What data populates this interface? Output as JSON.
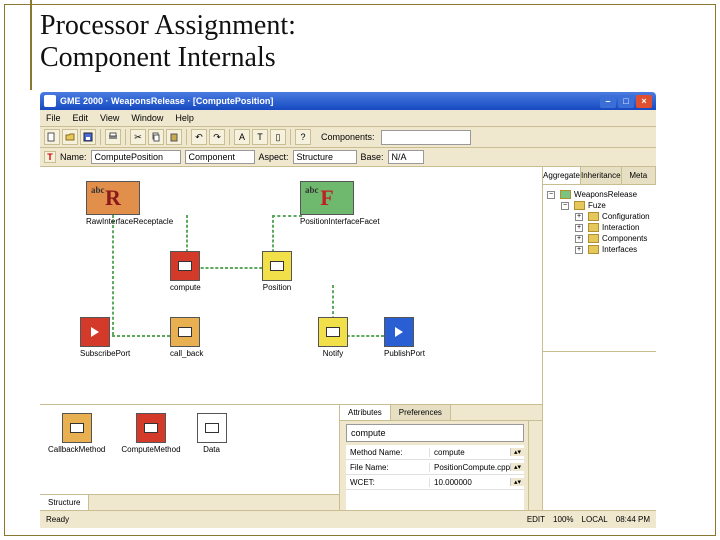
{
  "slide": {
    "title_line1": "Processor Assignment:",
    "title_line2": "Component Internals"
  },
  "window": {
    "title": "GME 2000 · WeaponsRelease · [ComputePosition]",
    "menu": [
      "File",
      "Edit",
      "View",
      "Window",
      "Help"
    ],
    "toolbar_components_label": "Components:",
    "optionbar": {
      "name_label": "Name:",
      "name_value": "ComputePosition",
      "base_label": "Component",
      "aspect_label": "Aspect:",
      "aspect_value": "Structure",
      "base2_label": "Base:",
      "base2_value": "N/A"
    }
  },
  "canvas": {
    "nodes": {
      "receptacle": {
        "letter": "R",
        "caption": "RawInterfaceReceptacle"
      },
      "facet": {
        "letter": "F",
        "caption": "PositionInterfaceFacet"
      },
      "compute": {
        "caption": "compute"
      },
      "position": {
        "caption": "Position"
      },
      "subscribe": {
        "caption": "SubscribePort"
      },
      "callback": {
        "caption": "call_back"
      },
      "notify": {
        "caption": "Notify"
      },
      "publish": {
        "caption": "PublishPort"
      }
    }
  },
  "sidebar": {
    "tabs": [
      "Aggregate",
      "Inheritance",
      "Meta"
    ],
    "tree": {
      "root": "WeaponsRelease",
      "children": [
        {
          "label": "Fuze",
          "children": [
            "Configuration",
            "Interaction",
            "Components",
            "Interfaces"
          ]
        }
      ]
    }
  },
  "palette": {
    "items": [
      {
        "label": "CallbackMethod",
        "box_class": "port-orange"
      },
      {
        "label": "ComputeMethod",
        "box_class": "port-red"
      },
      {
        "label": "Data",
        "box_class": "port-white"
      }
    ],
    "tab": "Structure"
  },
  "props": {
    "tabs": [
      "Attributes",
      "Preferences"
    ],
    "object_name": "compute",
    "rows": [
      {
        "key": "Method Name:",
        "val": "compute"
      },
      {
        "key": "File Name:",
        "val": "PositionCompute.cpp"
      },
      {
        "key": "WCET:",
        "val": "10.000000"
      }
    ]
  },
  "status": {
    "left": "Ready",
    "right": [
      "EDIT",
      "100%",
      "LOCAL",
      "08:44 PM"
    ]
  }
}
